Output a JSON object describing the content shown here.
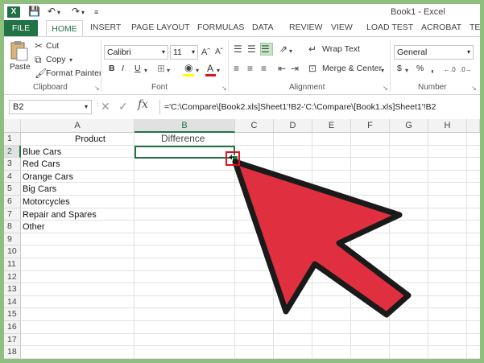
{
  "title_bar": {
    "logo": "X",
    "window_title": "Book1 - Excel",
    "qa_icons": [
      "save-icon",
      "undo-icon",
      "redo-icon",
      "customize-icon"
    ]
  },
  "tabs": [
    "FILE",
    "HOME",
    "INSERT",
    "PAGE LAYOUT",
    "FORMULAS",
    "DATA",
    "REVIEW",
    "VIEW",
    "LOAD TEST",
    "ACROBAT",
    "TE"
  ],
  "ribbon": {
    "clipboard": {
      "paste": "Paste",
      "cut": "Cut",
      "copy": "Copy",
      "format_painter": "Format Painter",
      "label": "Clipboard"
    },
    "font": {
      "font_name": "Calibri",
      "font_size": "11",
      "bold": "B",
      "italic": "I",
      "underline": "U",
      "label": "Font"
    },
    "alignment": {
      "wrap_text": "Wrap Text",
      "merge_center": "Merge & Center",
      "label": "Alignment"
    },
    "number": {
      "format": "General",
      "currency": "$",
      "percent": "%",
      "label": "Number"
    }
  },
  "formula_bar": {
    "name_box": "B2",
    "fx": "fx",
    "formula": "='C:\\Compare\\[Book2.xls]Sheet1'!B2-'C:\\Compare\\[Book1.xls]Sheet1'!B2"
  },
  "columns": [
    "A",
    "B",
    "C",
    "D",
    "E",
    "F",
    "G",
    "H"
  ],
  "rows": [
    "1",
    "2",
    "3",
    "4",
    "5",
    "6",
    "7",
    "8",
    "9",
    "10",
    "11",
    "12",
    "13",
    "14",
    "15",
    "16",
    "17",
    "18"
  ],
  "cells": {
    "A1": "Product",
    "B1": "Difference",
    "A2": "Blue Cars",
    "A3": "Red Cars",
    "A4": "Orange Cars",
    "A5": "Big Cars",
    "A6": "Motorcycles",
    "A7": "Repair and Spares",
    "A8": "Other"
  },
  "colors": {
    "excel_green": "#217346",
    "arrow_red": "#e03040",
    "frame_green": "#8fbf7f"
  }
}
